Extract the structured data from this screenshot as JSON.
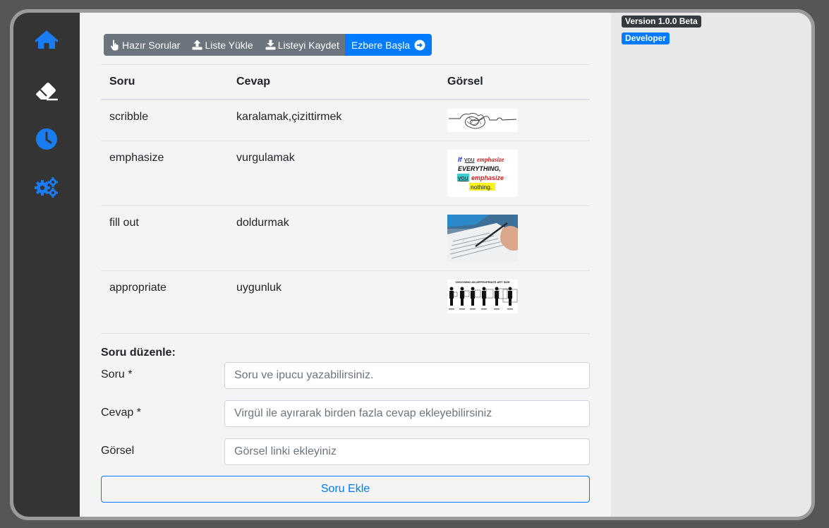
{
  "sidebar": {
    "items": [
      {
        "icon": "home-icon"
      },
      {
        "icon": "eraser-icon"
      },
      {
        "icon": "clock-icon"
      },
      {
        "icon": "gears-icon"
      }
    ],
    "accent": "#007bff"
  },
  "toolbar": {
    "ready_questions": "Hazır Sorular",
    "load_list": "Liste Yükle",
    "save_list": "Listeyi Kaydet",
    "start_memorize": "Ezbere Başla"
  },
  "table": {
    "headers": [
      "Soru",
      "Cevap",
      "Görsel"
    ],
    "rows": [
      {
        "question": "scribble",
        "answer": "karalamak,çizittirmek",
        "image": "scribble-image"
      },
      {
        "question": "emphasize",
        "answer": "vurgulamak",
        "image": "emphasize-image"
      },
      {
        "question": "fill out",
        "answer": "doldurmak",
        "image": "fill-out-image"
      },
      {
        "question": "appropriate",
        "answer": "uygunluk",
        "image": "appropriate-image"
      }
    ],
    "image_texts": {
      "emphasize": [
        "If",
        "you",
        "emphasize",
        "EVERYTHING,",
        "you",
        "emphasize",
        "nothing."
      ],
      "appropriate": "CHOOSING AN APPROPRIATE ART SIZE"
    }
  },
  "form": {
    "title": "Soru düzenle:",
    "question_label": "Soru *",
    "question_placeholder": "Soru ve ipucu yazabilirsiniz.",
    "answer_label": "Cevap *",
    "answer_placeholder": "Virgül ile ayırarak birden fazla cevap ekleyebilirsiniz",
    "image_label": "Görsel",
    "image_placeholder": "Görsel linki ekleyiniz",
    "submit": "Soru Ekle"
  },
  "badges": {
    "version": "Version 1.0.0 Beta",
    "developer": "Developer"
  }
}
